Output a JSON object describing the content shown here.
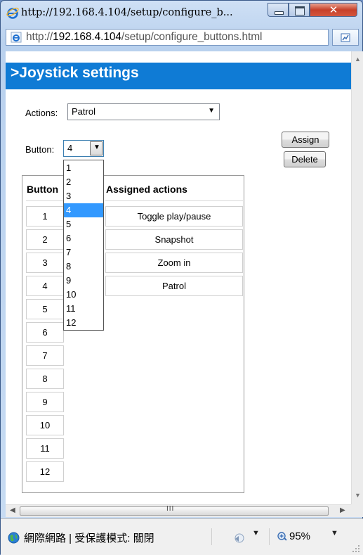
{
  "window": {
    "title": "http://192.168.4.104/setup/configure_b...",
    "minimize_icon": "minimize-icon",
    "maximize_icon": "maximize-icon",
    "close_icon": "close-icon"
  },
  "address_bar": {
    "prefix": "http://",
    "host": "192.168.4.104",
    "path": "/setup/configure_buttons.html",
    "compat_icon": "compatibility-view-icon"
  },
  "page": {
    "header_title": ">Joystick settings",
    "actions_label": "Actions:",
    "actions_value": "Patrol",
    "button_label": "Button:",
    "button_value": "4",
    "assign_label": "Assign",
    "delete_label": "Delete",
    "table": {
      "col_button": "Button",
      "col_actions": "Assigned actions",
      "numbers": [
        "1",
        "2",
        "3",
        "4",
        "5",
        "6",
        "7",
        "8",
        "9",
        "10",
        "11",
        "12"
      ],
      "actions": [
        "Toggle play/pause",
        "Snapshot",
        "Zoom in",
        "Patrol"
      ]
    },
    "dropdown_options": [
      "1",
      "2",
      "3",
      "4",
      "5",
      "6",
      "7",
      "8",
      "9",
      "10",
      "11",
      "12"
    ],
    "dropdown_selected": "4"
  },
  "scrollbar": {
    "grip": "III"
  },
  "status_bar": {
    "zone_text": "網際網路 | 受保護模式: 關閉",
    "zoom_text": "95%",
    "globe_icon": "globe-icon",
    "security_icon": "security-zone-icon",
    "zoom_icon": "zoom-icon"
  }
}
